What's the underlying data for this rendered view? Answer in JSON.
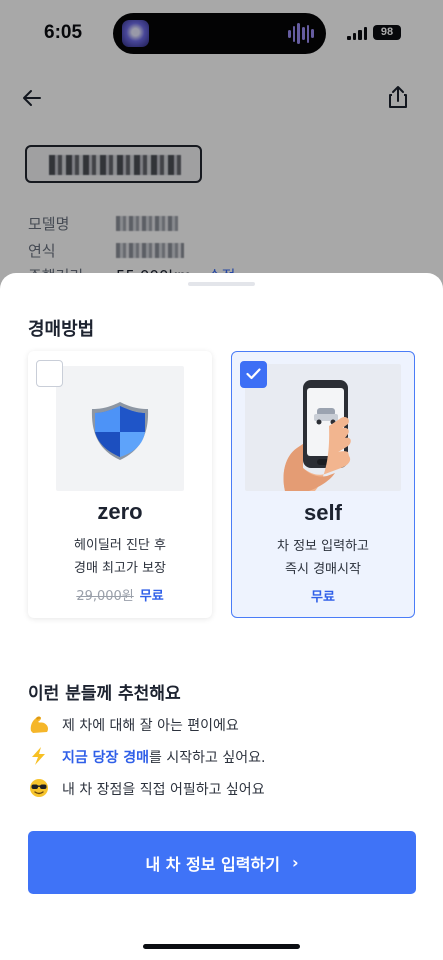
{
  "status_bar": {
    "time": "6:05",
    "battery": "98"
  },
  "background_page": {
    "info_rows": [
      {
        "label": "모델명"
      },
      {
        "label": "연식"
      },
      {
        "label": "주행거리",
        "value": "55,000km",
        "link": "수정"
      }
    ]
  },
  "sheet": {
    "section_title": "경매방법",
    "options": [
      {
        "name": "zero",
        "desc_line1": "헤이딜러 진단 후",
        "desc_line2": "경매 최고가 보장",
        "old_price": "29,000원",
        "price": "무료",
        "selected": false,
        "icon": "shield-icon"
      },
      {
        "name": "self",
        "desc_line1": "차 정보 입력하고",
        "desc_line2": "즉시 경매시작",
        "price": "무료",
        "selected": true,
        "icon": "hand-phone-icon"
      }
    ],
    "recommend_title": "이런 분들께 추천해요",
    "recommend_items": [
      {
        "icon": "flexed-arm-icon",
        "text": "제 차에 대해 잘 아는 편이에요"
      },
      {
        "icon": "lightning-icon",
        "highlight": "지금 당장 경매",
        "text": "를 시작하고 싶어요."
      },
      {
        "icon": "sunglasses-face-icon",
        "text": "내 차 장점을 직접 어필하고 싶어요"
      }
    ],
    "cta_label": "내 차 정보 입력하기",
    "cta_arrow": "›"
  },
  "colors": {
    "accent": "#3f73f7",
    "accent_text": "#2f5fe8",
    "selected_bg": "#eef3fe"
  }
}
